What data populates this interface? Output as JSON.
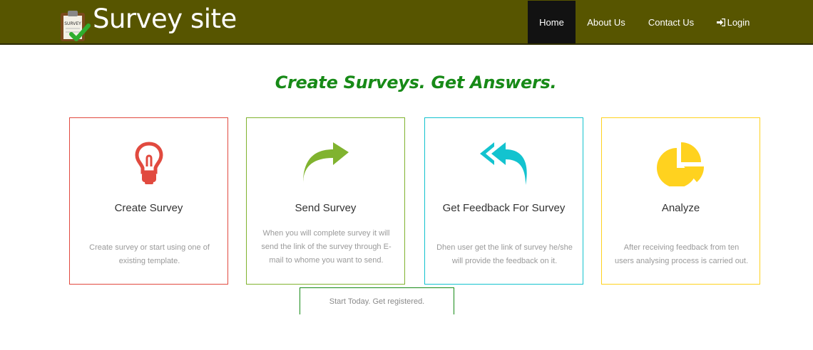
{
  "brand": {
    "title": "Survey site",
    "logo_icon": "survey-clipboard-icon",
    "logo_text": "SURVEY"
  },
  "nav": {
    "home": "Home",
    "about": "About Us",
    "contact": "Contact Us",
    "login": "Login",
    "login_icon": "sign-in-icon"
  },
  "headline": "Create Surveys. Get Answers.",
  "cards": [
    {
      "icon": "lightbulb-icon",
      "color": "#e14a3f",
      "title": "Create Survey",
      "text": "Create survey or start using one of existing template."
    },
    {
      "icon": "share-arrow-icon",
      "color": "#80b32f",
      "title": "Send Survey",
      "text": "When you will complete survey it will send the link of the survey through E-mail to whome you want to send."
    },
    {
      "icon": "reply-all-icon",
      "color": "#13c3cf",
      "title": "Get Feedback For Survey",
      "text": "Dhen user get the link of survey he/she will provide the feedback on it."
    },
    {
      "icon": "pie-chart-icon",
      "color": "#ffd21f",
      "title": "Analyze",
      "text": "After receiving feedback from ten users analysing process is carried out."
    }
  ],
  "start_button": "Start Today. Get registered.",
  "colors": {
    "navbar": "#575500",
    "active_nav": "#121212",
    "headline": "#178a17"
  }
}
